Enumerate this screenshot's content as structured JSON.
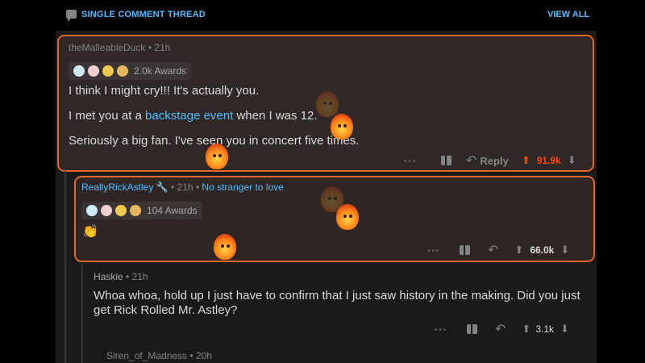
{
  "header": {
    "title": "SINGLE COMMENT THREAD",
    "view_all": "VIEW ALL"
  },
  "comments": [
    {
      "author": "theMalleableDuck",
      "time": "21h",
      "awards_label": "2.0k Awards",
      "paragraphs": [
        "I think I might cry!!! It's actually you.",
        "Seriously a big fan. I've seen you in concert five times."
      ],
      "p2_pre": "I met you at a ",
      "p2_link": "backstage event",
      "p2_post": " when I was 12.",
      "actions": {
        "more": "···",
        "reply": "Reply",
        "score": "91.9k"
      }
    },
    {
      "author": "ReallyRickAstley",
      "time": "21h",
      "flair": "No stranger to love",
      "awards_label": "104 Awards",
      "body": "👏",
      "actions": {
        "more": "···",
        "score": "66.0k"
      }
    },
    {
      "author": "Haskie",
      "time": "21h",
      "line1": "Whoa whoa, hold up I just have to confirm that I just saw history in the making. Did you just",
      "line2": "get Rick Rolled Mr. Astley?",
      "actions": {
        "more": "···",
        "score": "3.1k"
      }
    },
    {
      "author": "Siren_of_Madness",
      "time": "20h"
    }
  ],
  "colors": {
    "accent": "#4fbcff",
    "upvote_active": "#ff4500",
    "highlight_border": "#e2652b"
  },
  "icons": [
    "chat-bubble-icon",
    "gift-icon",
    "reply-icon",
    "upvote-icon",
    "downvote-icon",
    "fire-award-icon"
  ]
}
